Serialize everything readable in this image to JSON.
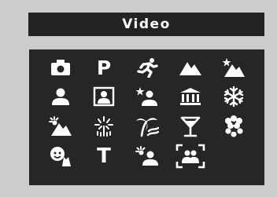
{
  "screen": {
    "title": "Video",
    "selected_mode": "movie-portrait"
  },
  "colors": {
    "background": "#cccccc",
    "panel": "#262626",
    "title_bar": "#232323",
    "icon": "#ffffff"
  },
  "modes": [
    {
      "icon": "camera-icon"
    },
    {
      "icon": "program-p-icon",
      "text": "P"
    },
    {
      "icon": "sports-runner-icon"
    },
    {
      "icon": "landscape-icon"
    },
    {
      "icon": "night-landscape-icon"
    },
    {
      "icon": "portrait-icon"
    },
    {
      "icon": "framed-portrait-icon"
    },
    {
      "icon": "night-portrait-icon"
    },
    {
      "icon": "museum-icon"
    },
    {
      "icon": "snowflake-icon"
    },
    {
      "icon": "sunset-icon"
    },
    {
      "icon": "fireworks-icon"
    },
    {
      "icon": "beach-icon"
    },
    {
      "icon": "party-cocktail-icon"
    },
    {
      "icon": "flowers-icon"
    },
    {
      "icon": "kids-pets-icon"
    },
    {
      "icon": "text-t-icon",
      "text": "T"
    },
    {
      "icon": "backlight-portrait-icon"
    },
    {
      "icon": "movie-portrait-icon"
    }
  ]
}
